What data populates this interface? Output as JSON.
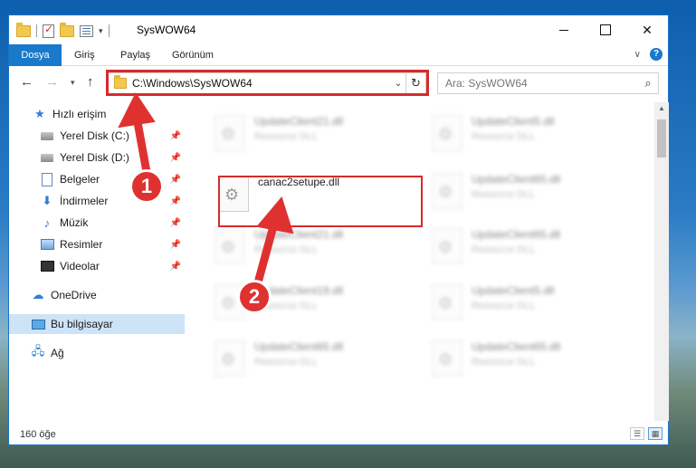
{
  "window": {
    "title": "SysWOW64"
  },
  "ribbon": {
    "tabs": [
      {
        "label": "Dosya"
      },
      {
        "label": "Giriş"
      },
      {
        "label": "Paylaş"
      },
      {
        "label": "Görünüm"
      }
    ]
  },
  "address": {
    "path": "C:\\Windows\\SysWOW64",
    "search_placeholder": "Ara: SysWOW64"
  },
  "sidebar": {
    "items": [
      {
        "label": "Hızlı erişim",
        "icon": "star-icon"
      },
      {
        "label": "Yerel Disk (C:)",
        "icon": "disk-icon"
      },
      {
        "label": "Yerel Disk (D:)",
        "icon": "disk-icon"
      },
      {
        "label": "Belgeler",
        "icon": "document-icon"
      },
      {
        "label": "İndirmeler",
        "icon": "download-icon"
      },
      {
        "label": "Müzik",
        "icon": "music-icon"
      },
      {
        "label": "Resimler",
        "icon": "pictures-icon"
      },
      {
        "label": "Videolar",
        "icon": "video-icon"
      },
      {
        "label": "OneDrive",
        "icon": "cloud-icon"
      },
      {
        "label": "Bu bilgisayar",
        "icon": "computer-icon"
      },
      {
        "label": "Ağ",
        "icon": "network-icon"
      }
    ]
  },
  "files": [
    {
      "name": "UpdateClient21.dll",
      "desc": "Resource DLL"
    },
    {
      "name": "UpdateClient5.dll",
      "desc": "Resource DLL"
    },
    {
      "name": "canac2setupe.dll",
      "desc": ""
    },
    {
      "name": "UpdateClient65.dll",
      "desc": "Resource DLL"
    },
    {
      "name": "UpdateClient21.dll",
      "desc": "Resource DLL"
    },
    {
      "name": "UpdateClient65.dll",
      "desc": "Resource DLL"
    },
    {
      "name": "UpdateClient19.dll",
      "desc": "Resource DLL"
    },
    {
      "name": "UpdateClient5.dll",
      "desc": "Resource DLL"
    },
    {
      "name": "UpdateClient65.dll",
      "desc": "Resource DLL"
    },
    {
      "name": "UpdateClient65.dll",
      "desc": "Resource DLL"
    }
  ],
  "status": {
    "item_count": "160 öğe"
  },
  "annotations": {
    "step1": "1",
    "step2": "2"
  },
  "colors": {
    "accent": "#1979ca",
    "highlight": "#d62b2b",
    "selected": "#cde3f7"
  }
}
